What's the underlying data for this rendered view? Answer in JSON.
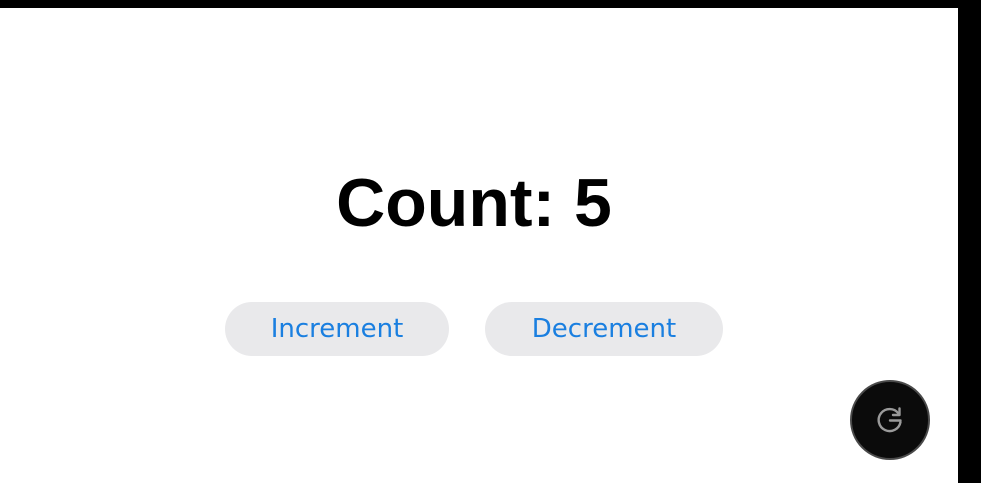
{
  "counter": {
    "title": "Count: 5",
    "value": 5
  },
  "buttons": {
    "increment_label": "Increment",
    "decrement_label": "Decrement"
  },
  "fab": {
    "icon": "refresh-icon"
  },
  "colors": {
    "accent": "#1a7fe0",
    "pill_background": "#e9e9eb",
    "fab_background": "#0b0b0b"
  }
}
